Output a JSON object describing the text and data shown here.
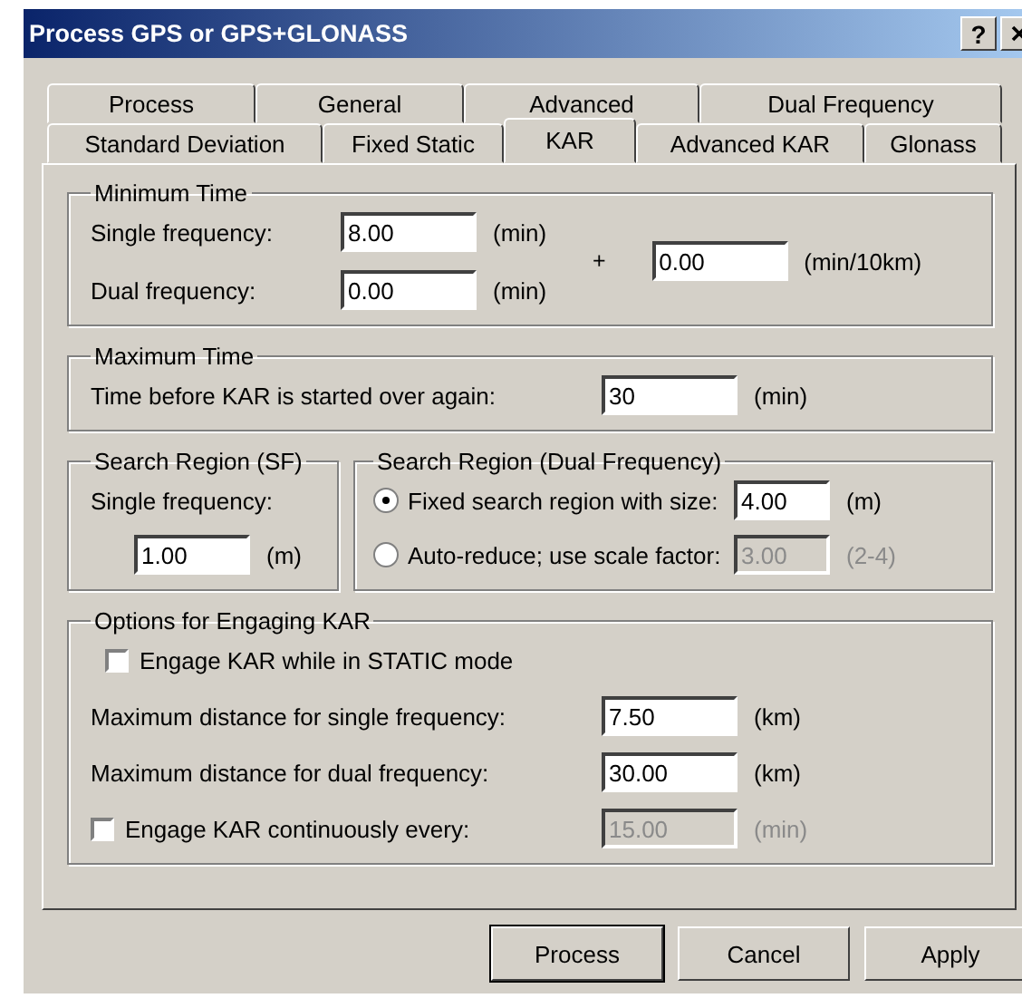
{
  "window": {
    "title": "Process GPS or GPS+GLONASS",
    "help": "?"
  },
  "tab_rows": [
    [
      {
        "label": "Process",
        "selected": false
      },
      {
        "label": "General",
        "selected": false
      },
      {
        "label": "Advanced",
        "selected": false
      },
      {
        "label": "Dual Frequency",
        "selected": false
      }
    ],
    [
      {
        "label": "Standard Deviation",
        "selected": false
      },
      {
        "label": "Fixed Static",
        "selected": false
      },
      {
        "label": "KAR",
        "selected": true
      },
      {
        "label": "Advanced KAR",
        "selected": false
      },
      {
        "label": "Glonass",
        "selected": false
      }
    ]
  ],
  "minimum_time": {
    "legend": "Minimum Time",
    "rows": [
      {
        "label": "Single frequency:",
        "value": "8.00",
        "unit": "(min)"
      },
      {
        "label": "Dual frequency:",
        "value": "0.00",
        "unit": "(min)"
      }
    ],
    "plus": "+",
    "extra_value": "0.00",
    "extra_unit": "(min/10km)"
  },
  "maximum_time": {
    "legend": "Maximum Time",
    "label": "Time before KAR is started over again:",
    "value": "30",
    "unit": "(min)"
  },
  "search_region_sf": {
    "legend": "Search Region (SF)",
    "label": "Single frequency:",
    "value": "1.00",
    "unit": "(m)"
  },
  "search_region_dual": {
    "legend": "Search Region (Dual Frequency)",
    "options": [
      {
        "label": "Fixed search region with size:",
        "selected": true,
        "value": "4.00",
        "unit": "(m)",
        "disabled": false
      },
      {
        "label": "Auto-reduce; use scale factor:",
        "selected": false,
        "value": "3.00",
        "unit": "(2-4)",
        "disabled": true
      }
    ]
  },
  "engaging": {
    "legend": "Options for Engaging KAR",
    "static_mode": {
      "label": "Engage KAR while in STATIC mode",
      "checked": false
    },
    "rows": [
      {
        "kind": "plain",
        "label": "Maximum distance for single frequency:",
        "value": "7.50",
        "unit": "(km)",
        "disabled": false
      },
      {
        "kind": "plain",
        "label": "Maximum distance for dual frequency:",
        "value": "30.00",
        "unit": "(km)",
        "disabled": false
      },
      {
        "kind": "checkbox",
        "label": "Engage KAR continuously every:",
        "checked": false,
        "value": "15.00",
        "unit": "(min)",
        "disabled": true
      }
    ]
  },
  "buttons": [
    {
      "label": "Process",
      "default": true
    },
    {
      "label": "Cancel",
      "default": false
    },
    {
      "label": "Apply",
      "default": false
    }
  ]
}
